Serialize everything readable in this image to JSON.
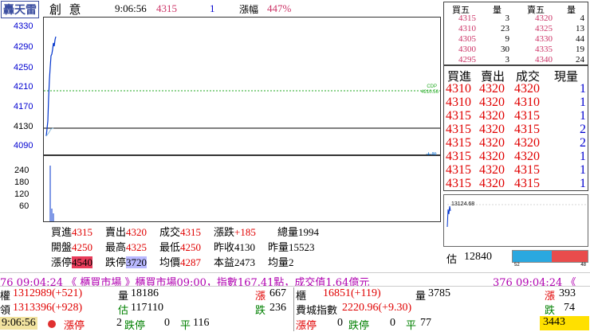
{
  "header": {
    "symbol": "轟天雷",
    "name": "創  意",
    "time": "9:06:56",
    "price": "4315",
    "change": "1",
    "pct_label": "漲幅",
    "pct_value": "447%"
  },
  "chart": {
    "y_labels": [
      "4330",
      "4290",
      "4250",
      "4210",
      "4170",
      "4130",
      "4090"
    ],
    "cdp_label": "CDP",
    "cdp_value": "4210.56",
    "big_label": "大盤",
    "vol_labels": [
      "240",
      "180",
      "120",
      "60"
    ]
  },
  "quote": {
    "row1": [
      {
        "label": "買進",
        "value": "4315"
      },
      {
        "label": "賣出",
        "value": "4320"
      },
      {
        "label": "成交",
        "value": "4315"
      },
      {
        "label": "漲跌",
        "value": "+185"
      },
      {
        "label": "總量",
        "value": "1994"
      }
    ],
    "row2": [
      {
        "label": "開盤",
        "value": "4250"
      },
      {
        "label": "最高",
        "value": "4325"
      },
      {
        "label": "最低",
        "value": "4250"
      },
      {
        "label": "昨收",
        "value": "4130"
      },
      {
        "label": "昨量",
        "value": "15523"
      }
    ],
    "row3": [
      {
        "label": "漲停",
        "value": "4540"
      },
      {
        "label": "跌停",
        "value": "3720"
      },
      {
        "label": "均價",
        "value": "4287"
      },
      {
        "label": "本益",
        "value": "2473"
      },
      {
        "label": "均量",
        "value": "2"
      }
    ]
  },
  "book": {
    "headers": [
      "買五",
      "量",
      "賣五",
      "量"
    ],
    "rows": [
      [
        "4315",
        "3",
        "4320",
        "4"
      ],
      [
        "4310",
        "23",
        "4325",
        "13"
      ],
      [
        "4305",
        "9",
        "4330",
        "44"
      ],
      [
        "4300",
        "30",
        "4335",
        "19"
      ],
      [
        "4295",
        "3",
        "4340",
        "24"
      ]
    ]
  },
  "ticks": {
    "headers": [
      "買進",
      "賣出",
      "成交",
      "現量"
    ],
    "rows": [
      [
        "4310",
        "4320",
        "4320",
        "1"
      ],
      [
        "4310",
        "4320",
        "4310",
        "1"
      ],
      [
        "4315",
        "4320",
        "4315",
        "1"
      ],
      [
        "4315",
        "4320",
        "4315",
        "2"
      ],
      [
        "4315",
        "4320",
        "4320",
        "2"
      ],
      [
        "4315",
        "4320",
        "4320",
        "1"
      ],
      [
        "4315",
        "4320",
        "4315",
        "1"
      ],
      [
        "4315",
        "4320",
        "4315",
        "1"
      ]
    ]
  },
  "mini": {
    "value_label": "13124.68",
    "est_label": "估",
    "est_value": "12840",
    "bar_left_label": "52",
    "bar_right_label": "48",
    "bar_left_share": 0.52
  },
  "ticker": {
    "text": "76 09:04:24 《 櫃買市場 》櫃買市場09:00，指數167.41點，成交值1.64億元",
    "text2": "376 09:04:24 《"
  },
  "bottom": {
    "l1_label": "權",
    "l1_value": "1312989(+521)",
    "l1_qty_label": "量",
    "l1_qty": "18186",
    "l1_up_label": "漲",
    "l1_up": "667",
    "l2_label": "領",
    "l2_value": "1313396(+928)",
    "l2_est_label": "估",
    "l2_est": "117110",
    "l2_down_label": "跌",
    "l2_down": "236",
    "l3_time": "9:06:56",
    "l3_limitup_label": "漲停",
    "l3_limitup": "2",
    "l3_limitdown_label": "跌停",
    "l3_limitdown": "0",
    "l3_flat_label": "平",
    "l3_flat": "116",
    "r1_label": "櫃",
    "r1_value": "16851(+119)",
    "r1_qty_label": "量",
    "r1_qty": "3785",
    "r1_up_label": "漲",
    "r1_up": "393",
    "r2_label": "費城指數",
    "r2_value": "2220.96(+9.30)",
    "r2_down_label": "跌",
    "r2_down": "74",
    "r3_limitup_label": "漲停",
    "r3_limitup": "0",
    "r3_limitdown_label": "跌停",
    "r3_limitdown": "0",
    "r3_flat_label": "平",
    "r3_flat": "77",
    "r3_box": "3443"
  }
}
